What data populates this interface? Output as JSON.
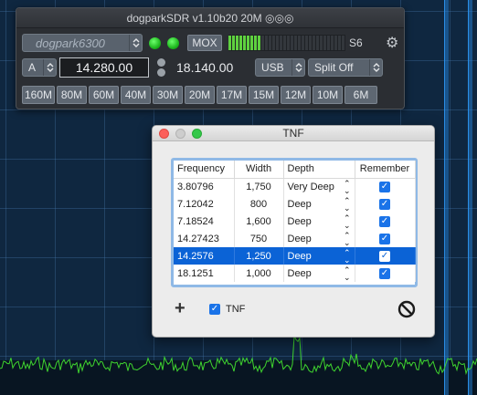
{
  "radio": {
    "title": "dogparkSDR v1.10b20 20M ◎◎◎",
    "radio_name": "dogpark6300",
    "mox_label": "MOX",
    "s_meter_level": "S6",
    "s_meter_fill": 0.28,
    "vfo_select": "A",
    "freq_a": "14.280.00",
    "freq_b": "18.140.00",
    "mode": "USB",
    "split": "Split Off",
    "bands": [
      "160M",
      "80M",
      "60M",
      "40M",
      "30M",
      "20M",
      "17M",
      "15M",
      "12M",
      "10M",
      "6M"
    ]
  },
  "tnf": {
    "title": "TNF",
    "columns": [
      "Frequency",
      "Width",
      "Depth",
      "Remember"
    ],
    "rows": [
      {
        "frequency": "3.80796",
        "width": "1,750",
        "depth": "Very Deep",
        "remember": true,
        "selected": false
      },
      {
        "frequency": "7.12042",
        "width": "800",
        "depth": "Deep",
        "remember": true,
        "selected": false
      },
      {
        "frequency": "7.18524",
        "width": "1,600",
        "depth": "Deep",
        "remember": true,
        "selected": false
      },
      {
        "frequency": "14.27423",
        "width": "750",
        "depth": "Deep",
        "remember": true,
        "selected": false
      },
      {
        "frequency": "14.2576",
        "width": "1,250",
        "depth": "Deep",
        "remember": true,
        "selected": true
      },
      {
        "frequency": "18.1251",
        "width": "1,000",
        "depth": "Deep",
        "remember": true,
        "selected": false
      }
    ],
    "enable_label": "TNF",
    "enabled": true
  },
  "colors": {
    "accent": "#0b63d6",
    "led_green": "#1fb81f",
    "spectrum_green": "#3fd42f",
    "tnf_marker": "#2a8ee6"
  },
  "icons": {
    "add": "plus-icon",
    "clear": "prohibit-icon",
    "settings": "gear-icon"
  }
}
